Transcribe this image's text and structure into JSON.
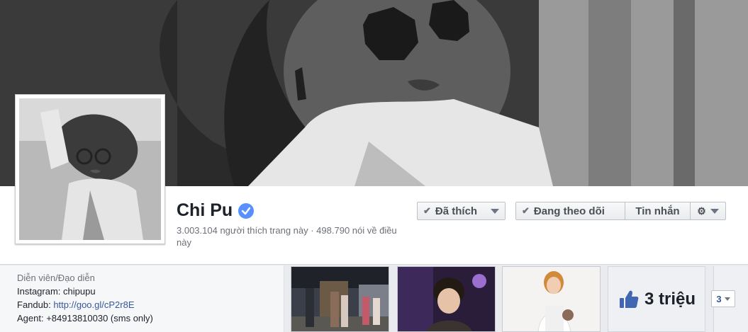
{
  "page": {
    "name": "Chi Pu",
    "verified_icon": "verified-badge-icon",
    "likes_text": "3.003.104 người thích trang này · 498.790 nói về điều này"
  },
  "actions": {
    "liked_label": "Đã thích",
    "following_label": "Đang theo dõi",
    "message_label": "Tin nhắn",
    "settings_icon": "gear-icon"
  },
  "about": {
    "category": "Diễn viên/Đạo diễn",
    "instagram_label": "Instagram: chipupu",
    "fandub_label": "Fandub: ",
    "fandub_link": "http://goo.gl/cP2r8E",
    "agent_label": "Agent: +84913810030 (sms only)"
  },
  "likes_widget": {
    "icon": "thumbs-up-icon",
    "count": "3 triệu"
  },
  "more": {
    "count": "3"
  },
  "colors": {
    "link": "#365899",
    "verified": "#5890ff",
    "like_blue": "#4267b2"
  }
}
